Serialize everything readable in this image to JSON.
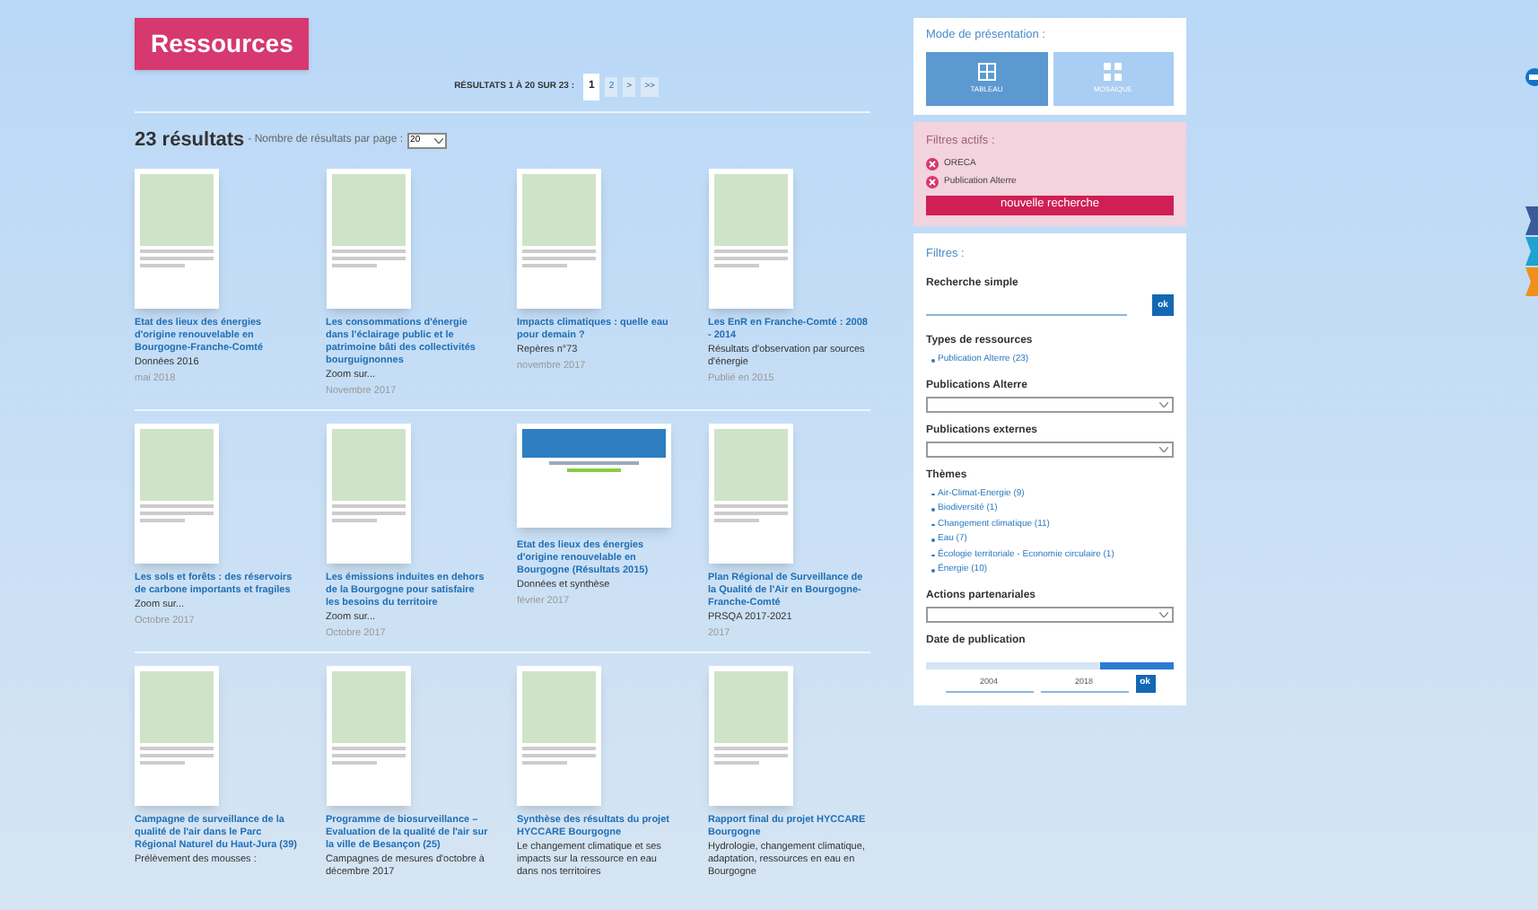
{
  "page_title": "Ressources",
  "pagination": {
    "summary": "RÉSULTATS 1 À 20 SUR 23 :",
    "pages": [
      {
        "label": "1",
        "selected": true
      },
      {
        "label": "2",
        "selected": false
      },
      {
        "label": ">",
        "selected": false
      },
      {
        "label": ">>",
        "selected": false
      }
    ]
  },
  "results": {
    "count": "23 résultats",
    "per_page_label": "- Nombre de résultats par page :",
    "per_page_value": "20"
  },
  "items": [
    {
      "title": "Etat des lieux des énergies d'origine renouvelable en Bourgogne-Franche-Comté",
      "subtitle": "Données 2016",
      "date": "mai 2018",
      "kind": "portrait"
    },
    {
      "title": "Les consommations d'énergie dans l'éclairage public et le patrimoine bâti des collectivités bourguignonnes",
      "subtitle": "Zoom sur...",
      "date": "Novembre 2017",
      "kind": "portrait"
    },
    {
      "title": "Impacts climatiques : quelle eau pour demain ?",
      "subtitle": "Repères n°73",
      "date": "novembre 2017",
      "kind": "portrait"
    },
    {
      "title": "Les EnR en Franche-Comté : 2008 - 2014",
      "subtitle": "Résultats d'observation par sources d'énergie",
      "date": "Publié en 2015",
      "kind": "portrait"
    },
    {
      "title": "Les sols et forêts : des réservoirs de carbone importants et fragiles",
      "subtitle": "Zoom sur...",
      "date": "Octobre 2017",
      "kind": "portrait"
    },
    {
      "title": "Les émissions induites en dehors de la Bourgogne pour satisfaire les besoins du territoire",
      "subtitle": "Zoom sur...",
      "date": "Octobre 2017",
      "kind": "portrait"
    },
    {
      "title": "Etat des lieux des énergies d'origine renouvelable en Bourgogne (Résultats 2015)",
      "subtitle": "Données et synthèse",
      "date": "février 2017",
      "kind": "landscape"
    },
    {
      "title": "Plan Régional de Surveillance de la Qualité de l'Air en Bourgogne-Franche-Comté",
      "subtitle": "PRSQA 2017-2021",
      "date": "2017",
      "kind": "portrait"
    },
    {
      "title": "Campagne de surveillance de la qualité de l'air dans le Parc Régional Naturel du Haut-Jura (39)",
      "subtitle": "Prélèvement des mousses :",
      "kind": "portrait"
    },
    {
      "title": "Programme de biosurveillance – Evaluation de la qualité de l'air sur la ville de Besançon (25)",
      "subtitle": "Campagnes de mesures d'octobre à décembre 2017",
      "kind": "portrait"
    },
    {
      "title": "Synthèse des résultats du projet HYCCARE Bourgogne",
      "subtitle": "Le changement climatique et ses impacts sur la ressource en eau dans nos territoires",
      "kind": "portrait"
    },
    {
      "title": "Rapport final du projet HYCCARE Bourgogne",
      "subtitle": "Hydrologie, changement climatique, adaptation, ressources en eau en Bourgogne",
      "kind": "portrait"
    }
  ],
  "sidebar": {
    "presentation": {
      "title": "Mode de présentation :",
      "modes": [
        {
          "label": "TABLEAU",
          "kind": "table",
          "selected": true
        },
        {
          "label": "MOSAIQUE",
          "kind": "mosaic",
          "selected": false
        }
      ]
    },
    "active_filters": {
      "title": "Filtres actifs :",
      "filters": [
        "ORECA",
        "Publication Alterre"
      ],
      "button": "nouvelle recherche"
    },
    "filters": {
      "title": "Filtres :",
      "simple_search": {
        "label": "Recherche simple",
        "button": "ok"
      },
      "resource_types": {
        "label": "Types de ressources",
        "items": [
          "Publication Alterre (23)"
        ]
      },
      "alterre_publications": {
        "label": "Publications Alterre"
      },
      "external_publications": {
        "label": "Publications externes"
      },
      "themes": {
        "label": "Thèmes",
        "items": [
          "Air-Climat-Energie (9)",
          "Biodiversité (1)",
          "Changement climatique (11)",
          "Eau (7)",
          "Écologie territoriale - Economie circulaire (1)",
          "Énergie (10)"
        ]
      },
      "partner_actions": {
        "label": "Actions partenariales"
      },
      "publication_date": {
        "label": "Date de publication",
        "level": 0.3,
        "from": "2004",
        "to": "2018",
        "button": "ok"
      }
    }
  }
}
